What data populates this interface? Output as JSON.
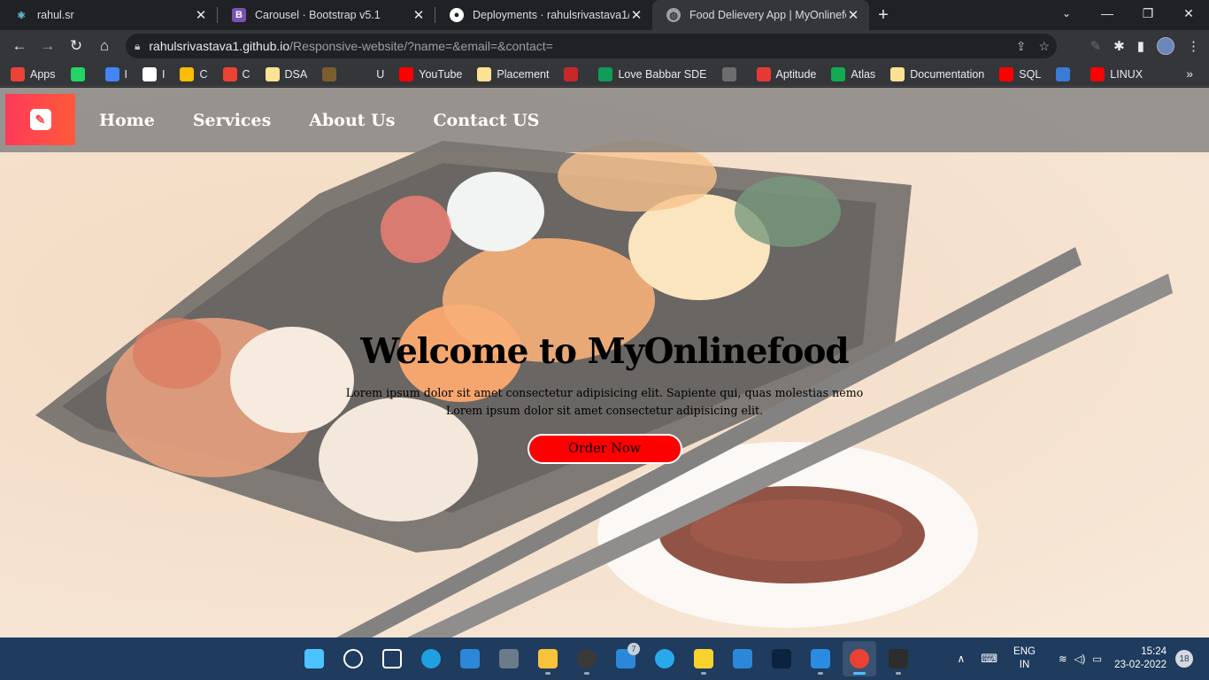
{
  "browser": {
    "tabs": [
      {
        "title": "rahul.sr",
        "icon": "react-icon"
      },
      {
        "title": "Carousel · Bootstrap v5.1",
        "icon": "bootstrap-icon"
      },
      {
        "title": "Deployments · rahulsrivastava1/R",
        "icon": "github-icon"
      },
      {
        "title": "Food Delievery App | MyOnlinefo",
        "icon": "globe-icon"
      }
    ],
    "url_host": "rahulsrivastava1.github.io",
    "url_path": "/Responsive-website/?name=&email=&contact=",
    "bookmarks": [
      {
        "label": "Apps",
        "icon": "apps-grid-icon",
        "color": "#ea4335"
      },
      {
        "label": "",
        "icon": "whatsapp-icon",
        "color": "#25d366"
      },
      {
        "label": "I",
        "icon": "google-icon",
        "color": "#4285f4"
      },
      {
        "label": "I",
        "icon": "github-icon",
        "color": "#ffffff"
      },
      {
        "label": "C",
        "icon": "classroom-icon",
        "color": "#fbbc04"
      },
      {
        "label": "C",
        "icon": "gmail-icon",
        "color": "#ea4335"
      },
      {
        "label": "DSA",
        "icon": "folder-icon",
        "color": "#fde293"
      },
      {
        "label": "",
        "icon": "codechef-icon",
        "color": "#7b5e2e"
      },
      {
        "label": "U",
        "icon": "blank-icon",
        "color": "#35363a"
      },
      {
        "label": "YouTube",
        "icon": "youtube-icon",
        "color": "#ff0000"
      },
      {
        "label": "Placement",
        "icon": "folder-icon",
        "color": "#fde293"
      },
      {
        "label": "",
        "icon": "pattern-icon",
        "color": "#c62828"
      },
      {
        "label": "Love Babbar SDE",
        "icon": "sheet-icon",
        "color": "#0f9d58"
      },
      {
        "label": "",
        "icon": "cc-icon",
        "color": "#6d6d6d"
      },
      {
        "label": "Aptitude",
        "icon": "c-icon",
        "color": "#e53935"
      },
      {
        "label": "Atlas",
        "icon": "mongodb-icon",
        "color": "#13aa52"
      },
      {
        "label": "Documentation",
        "icon": "folder-icon",
        "color": "#fde293"
      },
      {
        "label": "SQL",
        "icon": "youtube-icon",
        "color": "#ff0000"
      },
      {
        "label": "",
        "icon": "gfg-icon",
        "color": "#3a7bd5"
      },
      {
        "label": "LINUX",
        "icon": "youtube-icon",
        "color": "#ff0000"
      }
    ]
  },
  "site": {
    "nav": [
      "Home",
      "Services",
      "About Us",
      "Contact US"
    ],
    "hero_title": "Welcome to MyOnlinefood",
    "hero_line1": "Lorem ipsum dolor sit amet consectetur adipisicing elit. Sapiente qui, quas molestias nemo",
    "hero_line2": "Lorem ipsum dolor sit amet consectetur adipisicing elit.",
    "order_button": "Order Now",
    "accent": "#ff0000"
  },
  "taskbar": {
    "apps": [
      {
        "name": "windows-start-icon",
        "color": "#4cc2ff"
      },
      {
        "name": "search-icon",
        "color": "#ffffff"
      },
      {
        "name": "task-view-icon",
        "color": "#ffffff"
      },
      {
        "name": "edge-icon",
        "color": "#1fa0e0"
      },
      {
        "name": "mail-icon",
        "color": "#2b88d8"
      },
      {
        "name": "calculator-icon",
        "color": "#6b7b8c"
      },
      {
        "name": "file-explorer-icon",
        "color": "#f8c23a"
      },
      {
        "name": "media-player-icon",
        "color": "#3a3a3a"
      },
      {
        "name": "store-icon",
        "color": "#2b88d8"
      },
      {
        "name": "telegram-icon",
        "color": "#29a9eb"
      },
      {
        "name": "sticky-notes-icon",
        "color": "#f7d32b"
      },
      {
        "name": "calendar-icon",
        "color": "#2b88d8"
      },
      {
        "name": "dev-icon",
        "color": "#0c2340"
      },
      {
        "name": "vscode-icon",
        "color": "#2a8ce0"
      },
      {
        "name": "chrome-icon",
        "color": "#e94235"
      },
      {
        "name": "terminal-icon",
        "color": "#2d2d2d"
      }
    ],
    "store_badge": "7",
    "lang_top": "ENG",
    "lang_bottom": "IN",
    "time": "15:24",
    "date": "23-02-2022",
    "notifications": "18"
  }
}
